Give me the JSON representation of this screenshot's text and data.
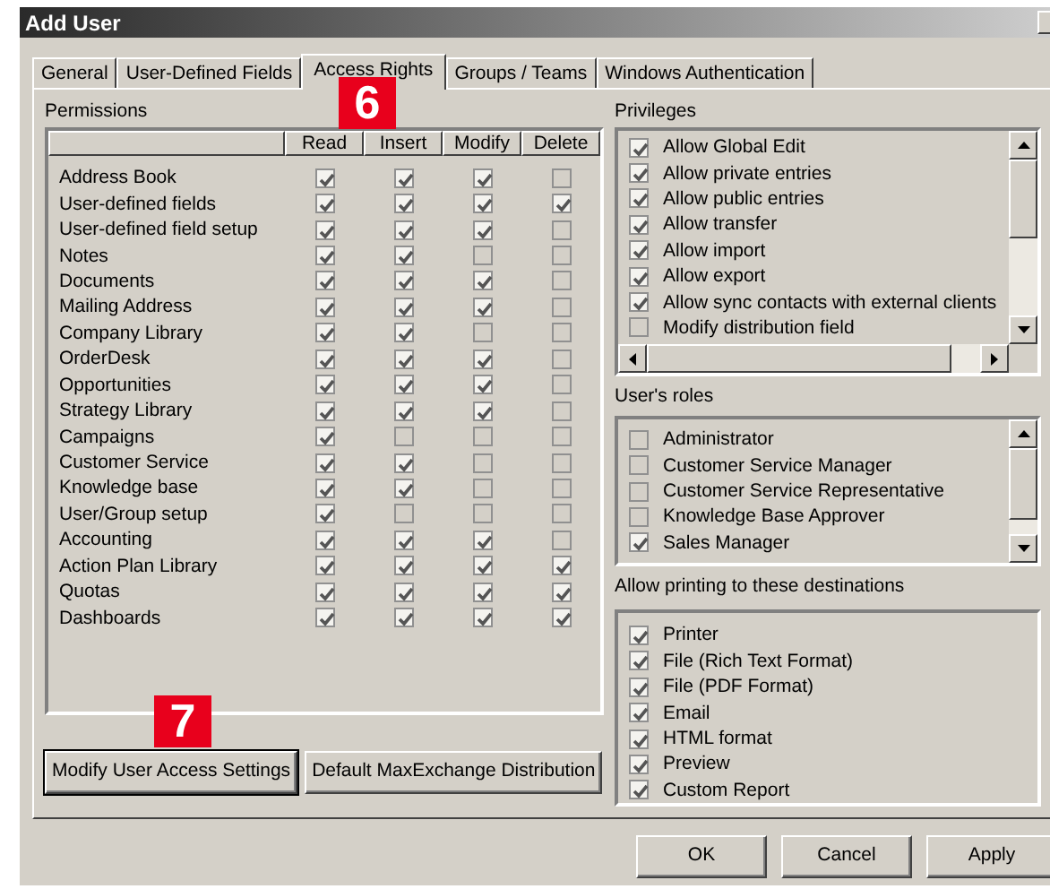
{
  "window": {
    "title": "Add User"
  },
  "tabs": [
    {
      "label": "General",
      "selected": false
    },
    {
      "label": "User-Defined Fields",
      "selected": false
    },
    {
      "label": "Access Rights",
      "selected": true
    },
    {
      "label": "Groups / Teams",
      "selected": false
    },
    {
      "label": "Windows Authentication",
      "selected": false
    }
  ],
  "permissions": {
    "title": "Permissions",
    "columns": [
      "Read",
      "Insert",
      "Modify",
      "Delete"
    ],
    "rows": [
      {
        "name": "Address Book",
        "checks": [
          true,
          true,
          true,
          false
        ]
      },
      {
        "name": "User-defined fields",
        "checks": [
          true,
          true,
          true,
          true
        ]
      },
      {
        "name": "User-defined field setup",
        "checks": [
          true,
          true,
          true,
          false
        ]
      },
      {
        "name": "Notes",
        "checks": [
          true,
          true,
          false,
          false
        ]
      },
      {
        "name": "Documents",
        "checks": [
          true,
          true,
          true,
          false
        ]
      },
      {
        "name": "Mailing Address",
        "checks": [
          true,
          true,
          true,
          false
        ]
      },
      {
        "name": "Company Library",
        "checks": [
          true,
          true,
          false,
          false
        ]
      },
      {
        "name": "OrderDesk",
        "checks": [
          true,
          true,
          true,
          false
        ]
      },
      {
        "name": "Opportunities",
        "checks": [
          true,
          true,
          true,
          false
        ]
      },
      {
        "name": "Strategy Library",
        "checks": [
          true,
          true,
          true,
          false
        ]
      },
      {
        "name": "Campaigns",
        "checks": [
          true,
          false,
          false,
          false
        ]
      },
      {
        "name": "Customer Service",
        "checks": [
          true,
          true,
          false,
          false
        ]
      },
      {
        "name": "Knowledge base",
        "checks": [
          true,
          true,
          false,
          false
        ]
      },
      {
        "name": "User/Group setup",
        "checks": [
          true,
          false,
          false,
          false
        ]
      },
      {
        "name": "Accounting",
        "checks": [
          true,
          true,
          true,
          false
        ]
      },
      {
        "name": "Action Plan Library",
        "checks": [
          true,
          true,
          true,
          true
        ]
      },
      {
        "name": "Quotas",
        "checks": [
          true,
          true,
          true,
          true
        ]
      },
      {
        "name": "Dashboards",
        "checks": [
          true,
          true,
          true,
          true
        ]
      }
    ]
  },
  "privileges": {
    "title": "Privileges",
    "items": [
      {
        "label": "Allow Global Edit",
        "checked": true
      },
      {
        "label": "Allow private entries",
        "checked": true
      },
      {
        "label": "Allow public entries",
        "checked": true
      },
      {
        "label": "Allow transfer",
        "checked": true
      },
      {
        "label": "Allow import",
        "checked": true
      },
      {
        "label": "Allow export",
        "checked": true
      },
      {
        "label": "Allow sync contacts with external clients",
        "checked": true
      },
      {
        "label": "Modify distribution field",
        "checked": false
      }
    ]
  },
  "roles": {
    "title": "User's roles",
    "items": [
      {
        "label": "Administrator",
        "checked": false
      },
      {
        "label": "Customer Service Manager",
        "checked": false
      },
      {
        "label": "Customer Service Representative",
        "checked": false
      },
      {
        "label": "Knowledge Base Approver",
        "checked": false
      },
      {
        "label": "Sales Manager",
        "checked": true
      }
    ]
  },
  "printing": {
    "title": "Allow printing to these destinations",
    "items": [
      {
        "label": "Printer",
        "checked": true
      },
      {
        "label": "File (Rich Text Format)",
        "checked": true
      },
      {
        "label": "File (PDF Format)",
        "checked": true
      },
      {
        "label": "Email",
        "checked": true
      },
      {
        "label": "HTML format",
        "checked": true
      },
      {
        "label": "Preview",
        "checked": true
      },
      {
        "label": "Custom Report",
        "checked": true
      }
    ]
  },
  "panel_buttons": [
    "Modify User Access Settings",
    "Default MaxExchange Distribution"
  ],
  "buttons": [
    "OK",
    "Cancel",
    "Apply"
  ],
  "callouts": [
    "6",
    "7"
  ]
}
